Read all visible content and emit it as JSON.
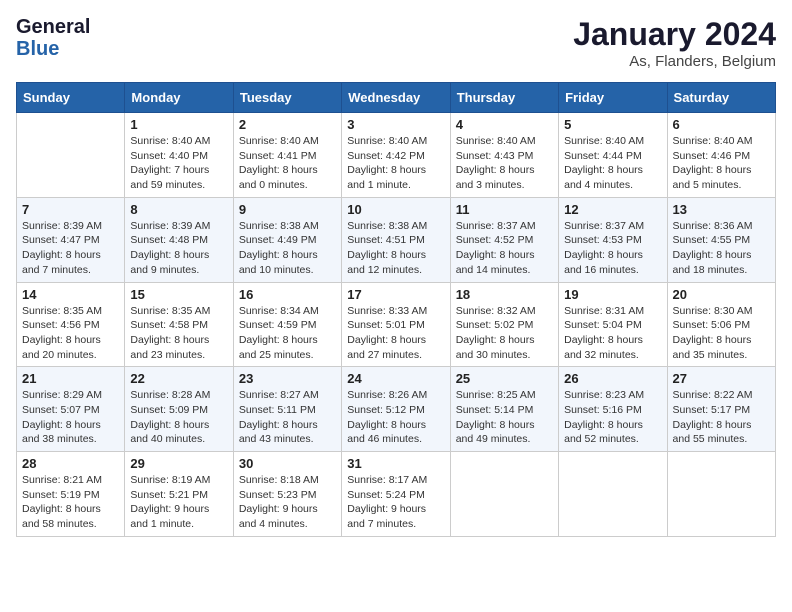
{
  "header": {
    "logo_general": "General",
    "logo_blue": "Blue",
    "month": "January 2024",
    "location": "As, Flanders, Belgium"
  },
  "days_of_week": [
    "Sunday",
    "Monday",
    "Tuesday",
    "Wednesday",
    "Thursday",
    "Friday",
    "Saturday"
  ],
  "weeks": [
    [
      {
        "day": "",
        "detail": ""
      },
      {
        "day": "1",
        "detail": "Sunrise: 8:40 AM\nSunset: 4:40 PM\nDaylight: 7 hours\nand 59 minutes."
      },
      {
        "day": "2",
        "detail": "Sunrise: 8:40 AM\nSunset: 4:41 PM\nDaylight: 8 hours\nand 0 minutes."
      },
      {
        "day": "3",
        "detail": "Sunrise: 8:40 AM\nSunset: 4:42 PM\nDaylight: 8 hours\nand 1 minute."
      },
      {
        "day": "4",
        "detail": "Sunrise: 8:40 AM\nSunset: 4:43 PM\nDaylight: 8 hours\nand 3 minutes."
      },
      {
        "day": "5",
        "detail": "Sunrise: 8:40 AM\nSunset: 4:44 PM\nDaylight: 8 hours\nand 4 minutes."
      },
      {
        "day": "6",
        "detail": "Sunrise: 8:40 AM\nSunset: 4:46 PM\nDaylight: 8 hours\nand 5 minutes."
      }
    ],
    [
      {
        "day": "7",
        "detail": "Sunrise: 8:39 AM\nSunset: 4:47 PM\nDaylight: 8 hours\nand 7 minutes."
      },
      {
        "day": "8",
        "detail": "Sunrise: 8:39 AM\nSunset: 4:48 PM\nDaylight: 8 hours\nand 9 minutes."
      },
      {
        "day": "9",
        "detail": "Sunrise: 8:38 AM\nSunset: 4:49 PM\nDaylight: 8 hours\nand 10 minutes."
      },
      {
        "day": "10",
        "detail": "Sunrise: 8:38 AM\nSunset: 4:51 PM\nDaylight: 8 hours\nand 12 minutes."
      },
      {
        "day": "11",
        "detail": "Sunrise: 8:37 AM\nSunset: 4:52 PM\nDaylight: 8 hours\nand 14 minutes."
      },
      {
        "day": "12",
        "detail": "Sunrise: 8:37 AM\nSunset: 4:53 PM\nDaylight: 8 hours\nand 16 minutes."
      },
      {
        "day": "13",
        "detail": "Sunrise: 8:36 AM\nSunset: 4:55 PM\nDaylight: 8 hours\nand 18 minutes."
      }
    ],
    [
      {
        "day": "14",
        "detail": "Sunrise: 8:35 AM\nSunset: 4:56 PM\nDaylight: 8 hours\nand 20 minutes."
      },
      {
        "day": "15",
        "detail": "Sunrise: 8:35 AM\nSunset: 4:58 PM\nDaylight: 8 hours\nand 23 minutes."
      },
      {
        "day": "16",
        "detail": "Sunrise: 8:34 AM\nSunset: 4:59 PM\nDaylight: 8 hours\nand 25 minutes."
      },
      {
        "day": "17",
        "detail": "Sunrise: 8:33 AM\nSunset: 5:01 PM\nDaylight: 8 hours\nand 27 minutes."
      },
      {
        "day": "18",
        "detail": "Sunrise: 8:32 AM\nSunset: 5:02 PM\nDaylight: 8 hours\nand 30 minutes."
      },
      {
        "day": "19",
        "detail": "Sunrise: 8:31 AM\nSunset: 5:04 PM\nDaylight: 8 hours\nand 32 minutes."
      },
      {
        "day": "20",
        "detail": "Sunrise: 8:30 AM\nSunset: 5:06 PM\nDaylight: 8 hours\nand 35 minutes."
      }
    ],
    [
      {
        "day": "21",
        "detail": "Sunrise: 8:29 AM\nSunset: 5:07 PM\nDaylight: 8 hours\nand 38 minutes."
      },
      {
        "day": "22",
        "detail": "Sunrise: 8:28 AM\nSunset: 5:09 PM\nDaylight: 8 hours\nand 40 minutes."
      },
      {
        "day": "23",
        "detail": "Sunrise: 8:27 AM\nSunset: 5:11 PM\nDaylight: 8 hours\nand 43 minutes."
      },
      {
        "day": "24",
        "detail": "Sunrise: 8:26 AM\nSunset: 5:12 PM\nDaylight: 8 hours\nand 46 minutes."
      },
      {
        "day": "25",
        "detail": "Sunrise: 8:25 AM\nSunset: 5:14 PM\nDaylight: 8 hours\nand 49 minutes."
      },
      {
        "day": "26",
        "detail": "Sunrise: 8:23 AM\nSunset: 5:16 PM\nDaylight: 8 hours\nand 52 minutes."
      },
      {
        "day": "27",
        "detail": "Sunrise: 8:22 AM\nSunset: 5:17 PM\nDaylight: 8 hours\nand 55 minutes."
      }
    ],
    [
      {
        "day": "28",
        "detail": "Sunrise: 8:21 AM\nSunset: 5:19 PM\nDaylight: 8 hours\nand 58 minutes."
      },
      {
        "day": "29",
        "detail": "Sunrise: 8:19 AM\nSunset: 5:21 PM\nDaylight: 9 hours\nand 1 minute."
      },
      {
        "day": "30",
        "detail": "Sunrise: 8:18 AM\nSunset: 5:23 PM\nDaylight: 9 hours\nand 4 minutes."
      },
      {
        "day": "31",
        "detail": "Sunrise: 8:17 AM\nSunset: 5:24 PM\nDaylight: 9 hours\nand 7 minutes."
      },
      {
        "day": "",
        "detail": ""
      },
      {
        "day": "",
        "detail": ""
      },
      {
        "day": "",
        "detail": ""
      }
    ]
  ]
}
